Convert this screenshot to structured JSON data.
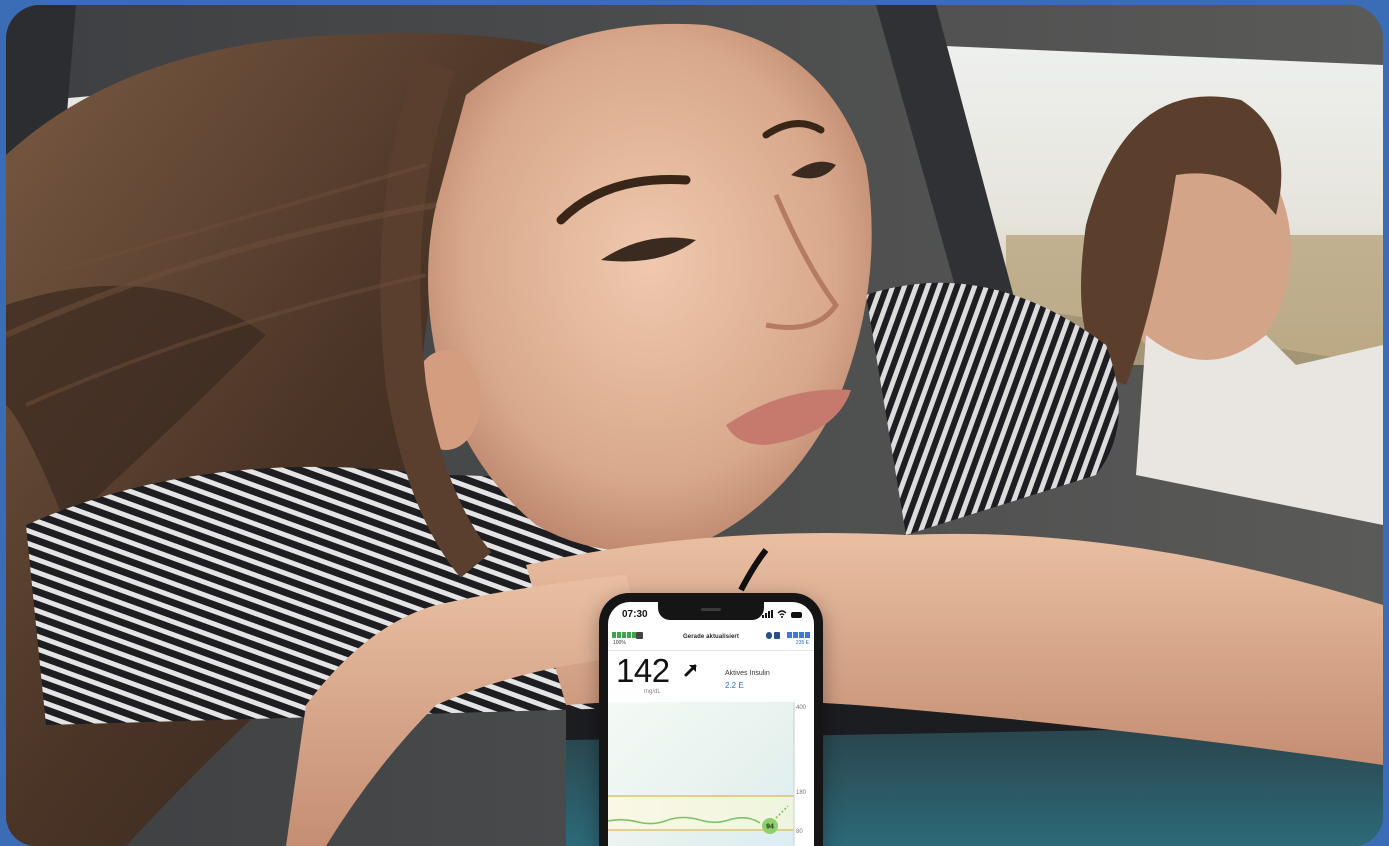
{
  "phone": {
    "time": "07:30",
    "pump_battery": "100%",
    "update_status": "Gerade aktualisiert",
    "reservoir": "235 E",
    "glucose": {
      "value": "142",
      "unit": "mg/dL",
      "trend": "rising-diagonal-arrow-icon"
    },
    "active_insulin": {
      "label": "Aktives Insulin",
      "value": "2.2 E"
    },
    "graph": {
      "axis_top": "400",
      "high_limit": "180",
      "low_limit": "80",
      "latest_reading": "94"
    },
    "colors": {
      "range_line": "#d9b75a",
      "trace": "#7cc26a",
      "battery": "#3fa34d",
      "reservoir": "#3c78d8",
      "active_insulin": "#2b6fd6"
    }
  },
  "background": {
    "description_icon": "photo-woman-leaning-out-car-window"
  }
}
